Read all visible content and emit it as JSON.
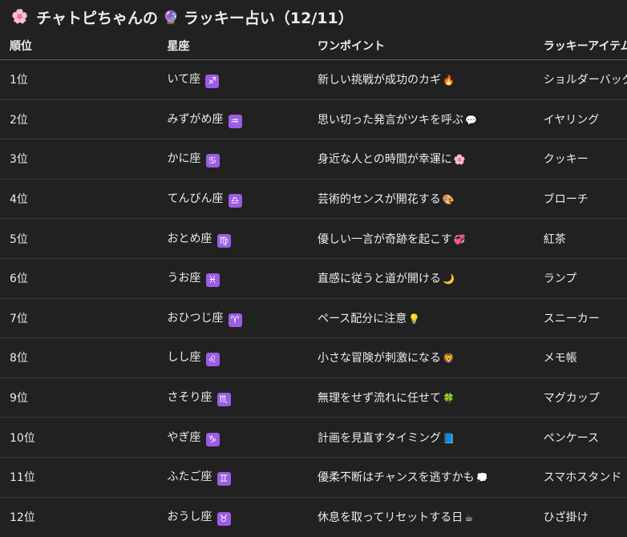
{
  "header": {
    "emoji_left": "🌸",
    "title_part1": "チャトピちゃんの",
    "emoji_mid": "🔮",
    "title_part2": "ラッキー占い（12/11）"
  },
  "table": {
    "columns": [
      "順位",
      "星座",
      "ワンポイント",
      "ラッキーアイテム"
    ],
    "rows": [
      {
        "rank": "1位",
        "sign": "いて座",
        "sign_icon": "♐",
        "tip": "新しい挑戦が成功のカギ",
        "tip_emoji": "🔥",
        "item": "ショルダーバッグ"
      },
      {
        "rank": "2位",
        "sign": "みずがめ座",
        "sign_icon": "♒",
        "tip": "思い切った発言がツキを呼ぶ",
        "tip_emoji": "💬",
        "item": "イヤリング"
      },
      {
        "rank": "3位",
        "sign": "かに座",
        "sign_icon": "♋",
        "tip": "身近な人との時間が幸運に",
        "tip_emoji": "🌸",
        "item": "クッキー"
      },
      {
        "rank": "4位",
        "sign": "てんびん座",
        "sign_icon": "♎",
        "tip": "芸術的センスが開花する",
        "tip_emoji": "🎨",
        "item": "ブローチ"
      },
      {
        "rank": "5位",
        "sign": "おとめ座",
        "sign_icon": "♍",
        "tip": "優しい一言が奇跡を起こす",
        "tip_emoji": "💞",
        "item": "紅茶"
      },
      {
        "rank": "6位",
        "sign": "うお座",
        "sign_icon": "♓",
        "tip": "直感に従うと道が開ける",
        "tip_emoji": "🌙",
        "item": "ランプ"
      },
      {
        "rank": "7位",
        "sign": "おひつじ座",
        "sign_icon": "♈",
        "tip": "ペース配分に注意",
        "tip_emoji": "💡",
        "item": "スニーカー"
      },
      {
        "rank": "8位",
        "sign": "しし座",
        "sign_icon": "♌",
        "tip": "小さな冒険が刺激になる",
        "tip_emoji": "🦁",
        "item": "メモ帳"
      },
      {
        "rank": "9位",
        "sign": "さそり座",
        "sign_icon": "♏",
        "tip": "無理をせず流れに任せて",
        "tip_emoji": "🍀",
        "item": "マグカップ"
      },
      {
        "rank": "10位",
        "sign": "やぎ座",
        "sign_icon": "♑",
        "tip": "計画を見直すタイミング",
        "tip_emoji": "📘",
        "item": "ペンケース"
      },
      {
        "rank": "11位",
        "sign": "ふたご座",
        "sign_icon": "♊",
        "tip": "優柔不断はチャンスを逃すかも",
        "tip_emoji": "💭",
        "item": "スマホスタンド"
      },
      {
        "rank": "12位",
        "sign": "おうし座",
        "sign_icon": "♉",
        "tip": "休息を取ってリセットする日",
        "tip_emoji": "☕",
        "item": "ひざ掛け"
      }
    ]
  },
  "colors": {
    "background": "#212121",
    "text": "#ececec",
    "zodiac_badge": "#9b5de5"
  }
}
